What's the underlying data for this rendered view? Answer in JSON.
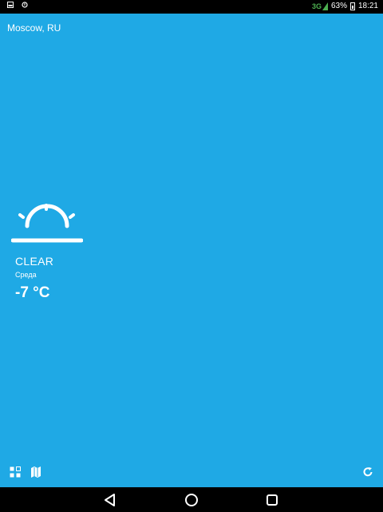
{
  "status_bar": {
    "network": "3G",
    "battery": "63%",
    "time": "18:21",
    "icons": [
      "image-icon",
      "notification-icon",
      "signal-icon",
      "battery-icon"
    ]
  },
  "weather": {
    "location": "Moscow, RU",
    "condition": "CLEAR",
    "day": "Среда",
    "temperature": "-7 °C",
    "icon": "sun-rising-icon",
    "accent_color": "#1fa9e5"
  },
  "tools": {
    "left_icons": [
      "grid-icon",
      "map-icon"
    ],
    "right_icon": "refresh-icon"
  },
  "navigation": {
    "icons": [
      "back-icon",
      "home-icon",
      "recent-apps-icon"
    ]
  }
}
